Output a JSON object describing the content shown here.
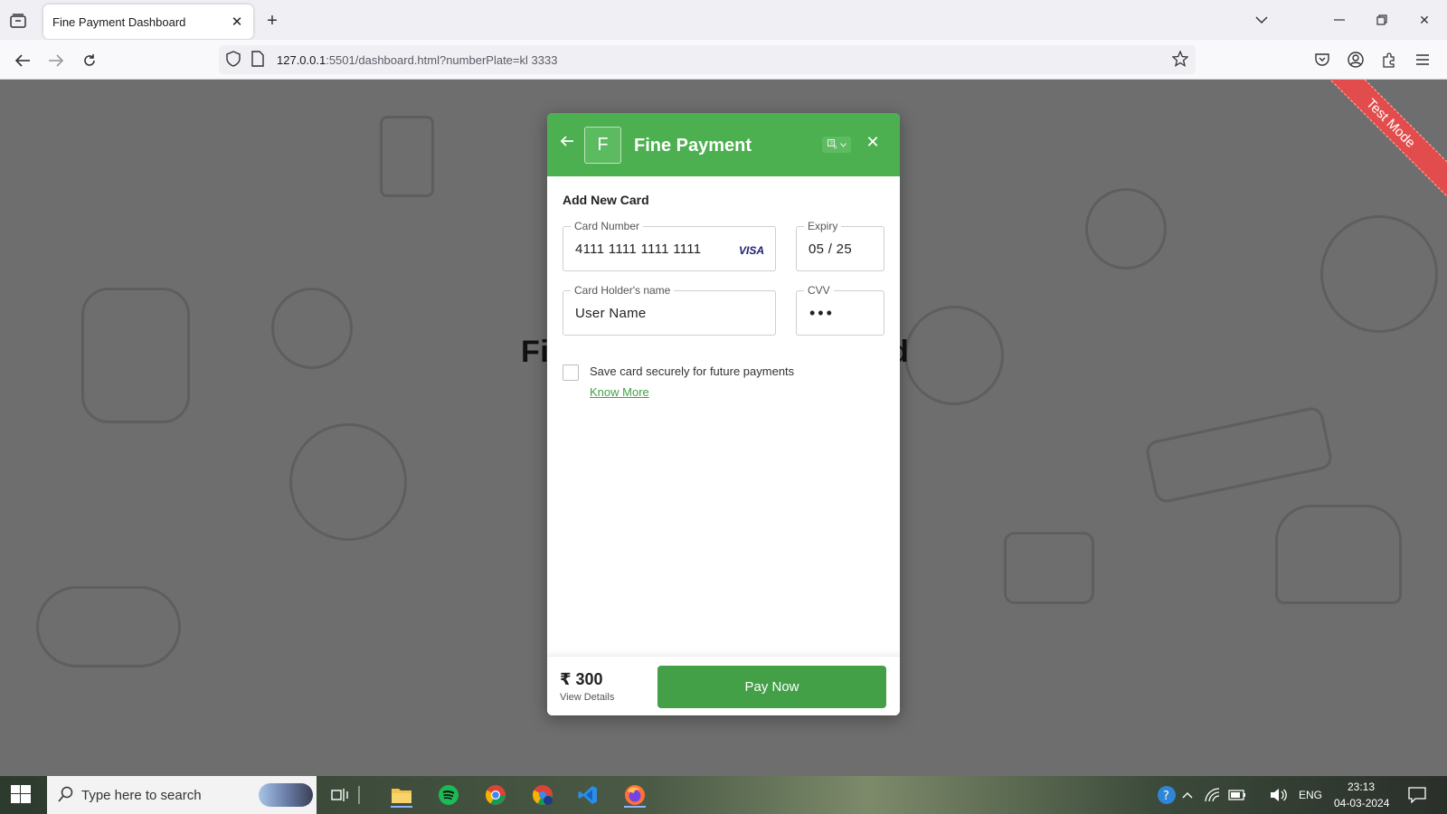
{
  "browser": {
    "tab_title": "Fine Payment Dashboard",
    "url_host": "127.0.0.1",
    "url_rest": ":5501/dashboard.html?numberPlate=kl 3333"
  },
  "page": {
    "heading_left": "Fi",
    "heading_right": "rd",
    "ribbon_text": "Test Mode"
  },
  "modal": {
    "logo_letter": "F",
    "merchant_name": "Fine Payment",
    "section_title": "Add New Card",
    "card_number": {
      "label": "Card Number",
      "value": "4111 1111 1111 1111",
      "brand": "VISA"
    },
    "expiry": {
      "label": "Expiry",
      "value": "05 / 25"
    },
    "holder_name": {
      "label": "Card Holder's name",
      "value": "User Name"
    },
    "cvv": {
      "label": "CVV",
      "value": "•••"
    },
    "save_card_label": "Save card securely for future payments",
    "know_more": "Know More",
    "amount": "₹ 300",
    "view_details": "View Details",
    "pay_button": "Pay Now"
  },
  "taskbar": {
    "search_placeholder": "Type here to search",
    "language": "ENG",
    "time": "23:13",
    "date": "04-03-2024"
  }
}
